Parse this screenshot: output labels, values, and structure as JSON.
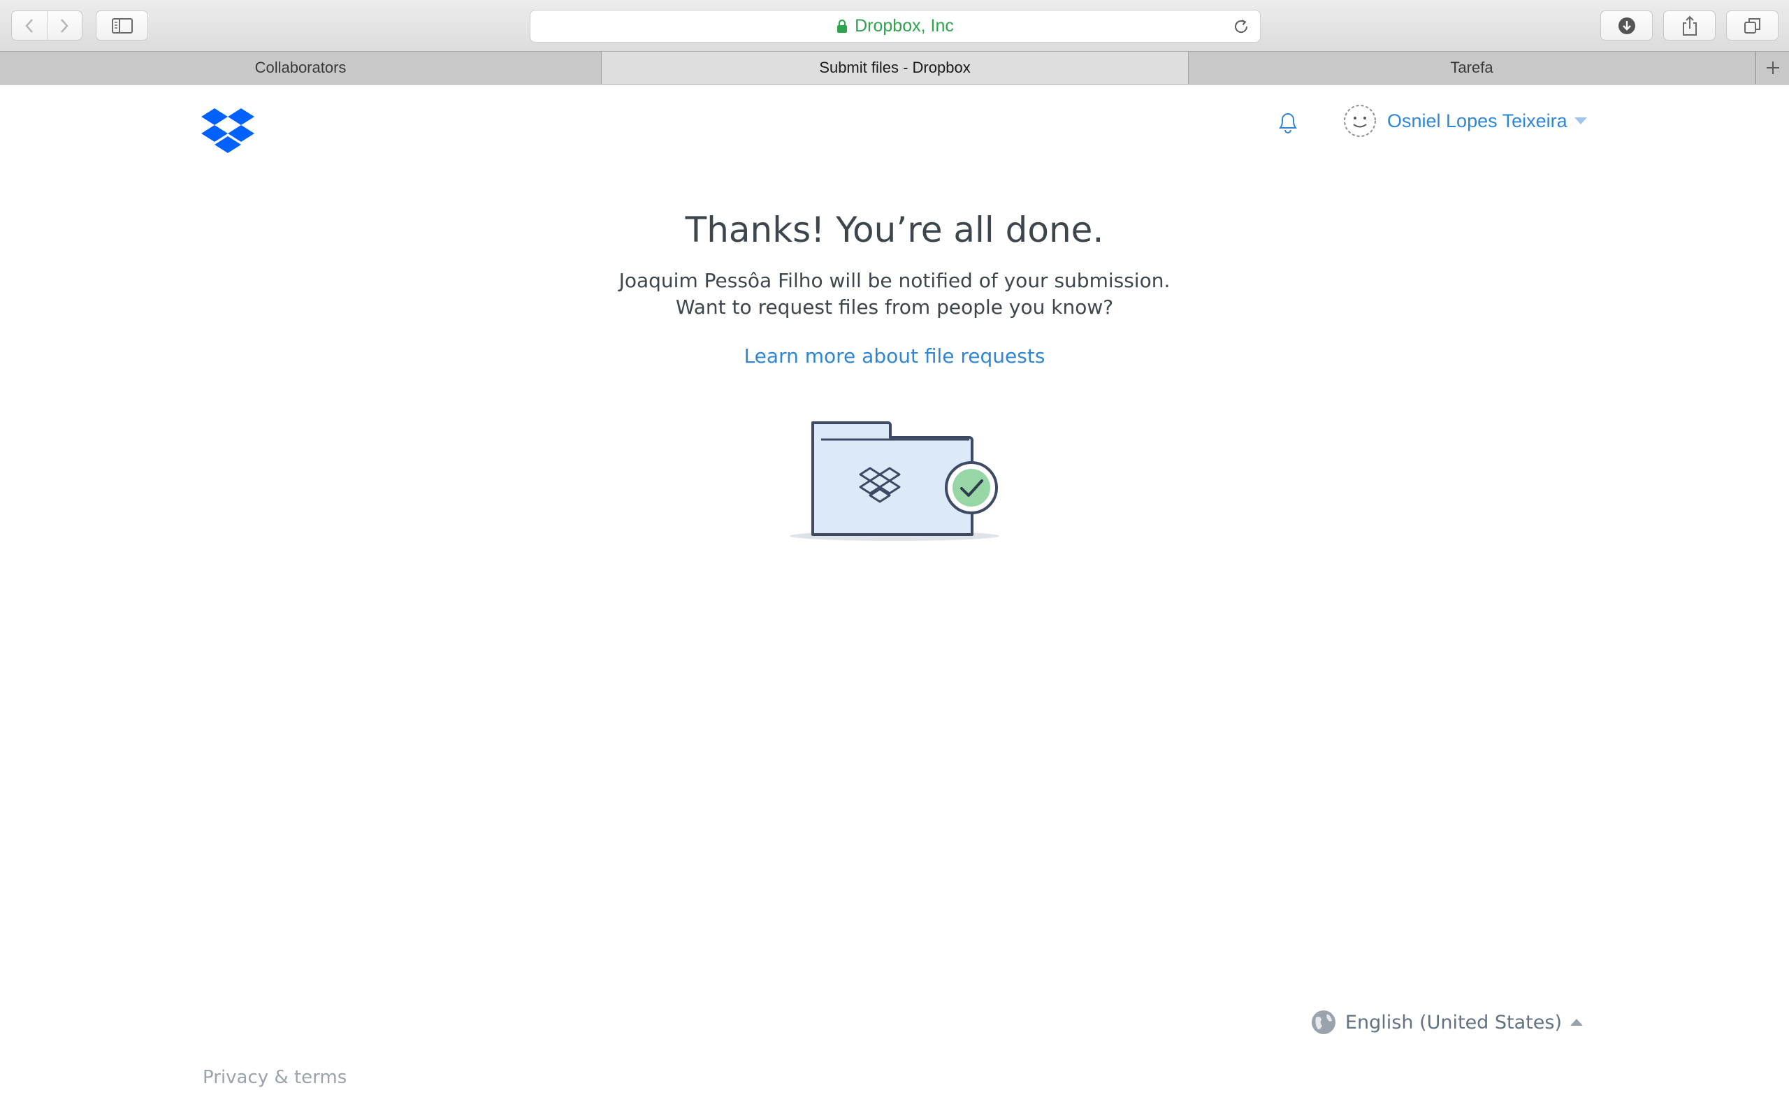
{
  "browser": {
    "url_label": "Dropbox, Inc",
    "tabs": [
      {
        "label": "Collaborators"
      },
      {
        "label": "Submit files - Dropbox"
      },
      {
        "label": "Tarefa"
      }
    ]
  },
  "header": {
    "user_name": "Osniel Lopes Teixeira"
  },
  "main": {
    "title": "Thanks! You’re all done.",
    "line1": "Joaquim Pessôa Filho will be notified of your submission.",
    "line2": "Want to request files from people you know?",
    "learn_link": "Learn more about file requests"
  },
  "footer": {
    "language": "English (United States)",
    "privacy": "Privacy & terms"
  },
  "colors": {
    "brand_blue": "#0061fe",
    "link_blue": "#2f86d6",
    "secure_green": "#2ea44f",
    "text_dark": "#3d464d"
  }
}
